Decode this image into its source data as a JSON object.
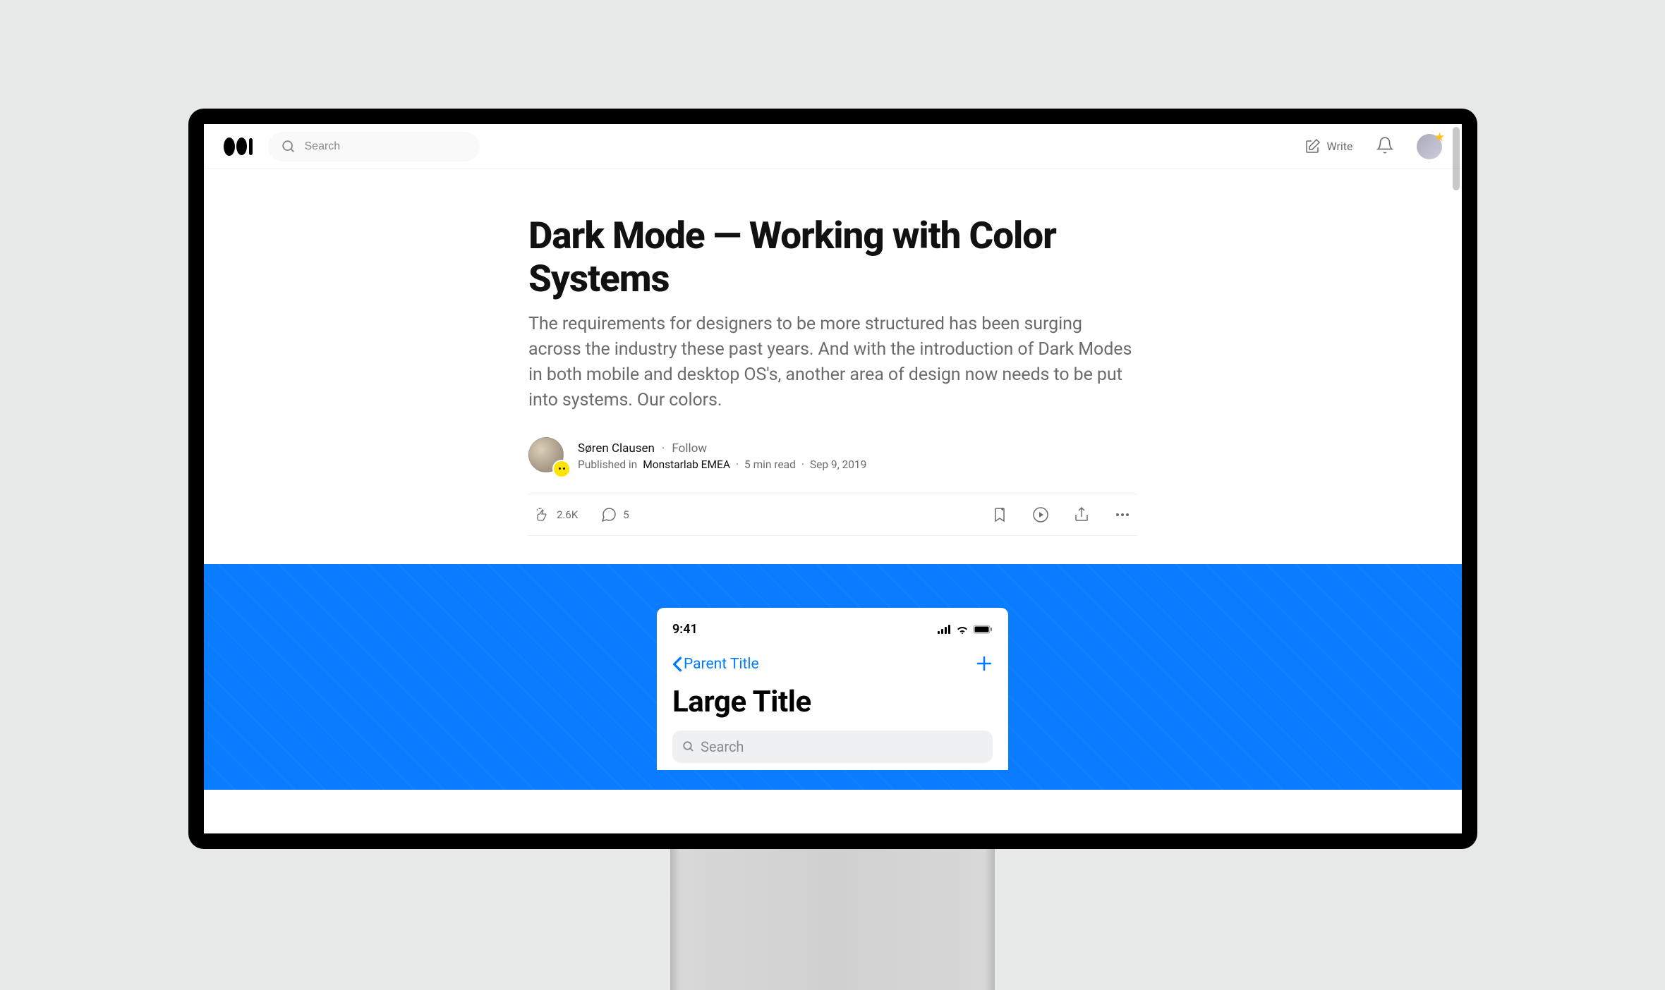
{
  "header": {
    "search_placeholder": "Search",
    "write_label": "Write"
  },
  "article": {
    "title": "Dark Mode — Working with Color Systems",
    "subtitle": "The requirements for designers to be more structured has been surging across the industry these past years. And with the introduction of Dark Modes in both mobile and desktop OS's, another area of design now needs to be put into systems. Our colors.",
    "author": "Søren Clausen",
    "follow": "Follow",
    "published_in_prefix": "Published in",
    "publication": "Monstarlab EMEA",
    "read_time": "5 min read",
    "date": "Sep 9, 2019",
    "claps": "2.6K",
    "responses": "5"
  },
  "phone": {
    "time": "9:41",
    "back_label": "Parent Title",
    "large_title": "Large Title",
    "search_placeholder": "Search"
  },
  "colors": {
    "hero_bg": "#0a7cff",
    "ios_blue": "#007aff"
  }
}
